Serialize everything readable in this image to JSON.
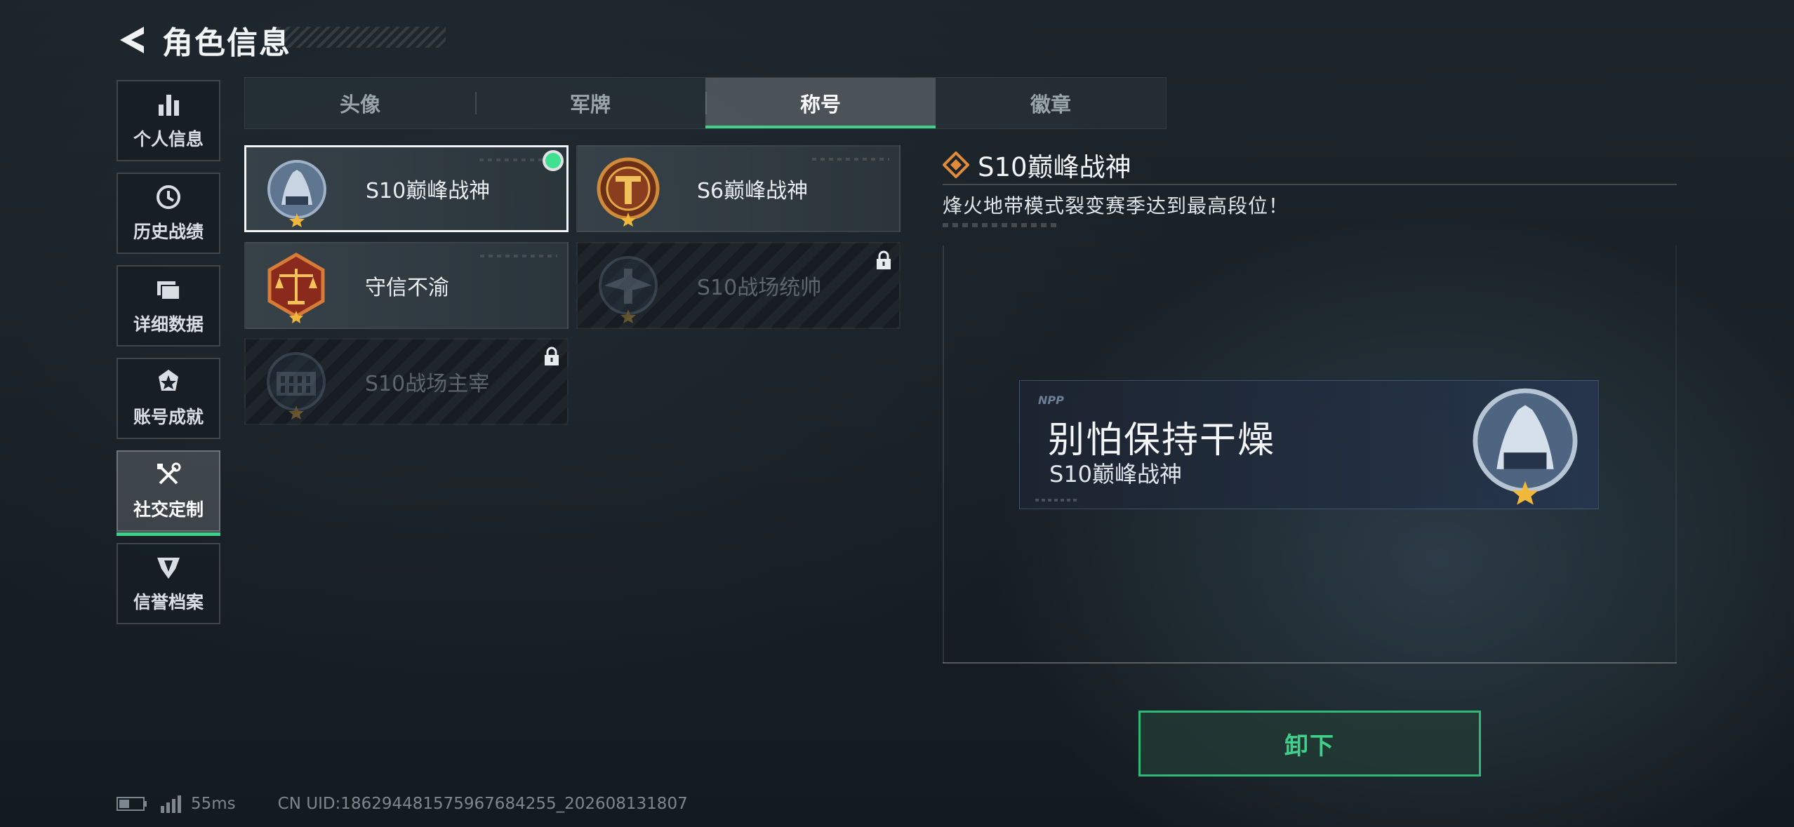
{
  "header": {
    "title": "角色信息"
  },
  "sidebar": {
    "items": [
      {
        "label": "个人信息",
        "icon": "bar-chart-icon",
        "active": false
      },
      {
        "label": "历史战绩",
        "icon": "history-clock-icon",
        "active": false
      },
      {
        "label": "详细数据",
        "icon": "folder-icon",
        "active": false
      },
      {
        "label": "账号成就",
        "icon": "achievement-icon",
        "active": false
      },
      {
        "label": "社交定制",
        "icon": "tools-icon",
        "active": true
      },
      {
        "label": "信誉档案",
        "icon": "shield-wing-icon",
        "active": false
      }
    ]
  },
  "tabs": [
    {
      "label": "头像",
      "active": false
    },
    {
      "label": "军牌",
      "active": false
    },
    {
      "label": "称号",
      "active": true
    },
    {
      "label": "徽章",
      "active": false
    }
  ],
  "titles": [
    {
      "name": "S10巅峰战神",
      "state": "equipped-selected",
      "emblem": "silver-arena-emblem-icon"
    },
    {
      "name": "S6巅峰战神",
      "state": "owned",
      "emblem": "bronze-t-emblem-icon"
    },
    {
      "name": "守信不渝",
      "state": "owned",
      "emblem": "scales-emblem-icon"
    },
    {
      "name": "S10战场统帅",
      "state": "locked",
      "emblem": "aircraft-emblem-icon"
    },
    {
      "name": "S10战场主宰",
      "state": "locked",
      "emblem": "colosseum-emblem-icon"
    }
  ],
  "detail": {
    "title": "S10巅峰战神",
    "description": "烽火地带模式裂变赛季达到最高段位！",
    "namecard": {
      "logo_text": "NPP",
      "player_name": "别怕保持干燥",
      "title": "S10巅峰战神"
    },
    "button_label": "卸下"
  },
  "footer": {
    "ping": "55ms",
    "uid": "CN UID:1862944815759676842​55_202608131807"
  },
  "colors": {
    "accent_green": "#3fd08a",
    "background": "#1a2329",
    "diamond_orange": "#e08a3a"
  }
}
